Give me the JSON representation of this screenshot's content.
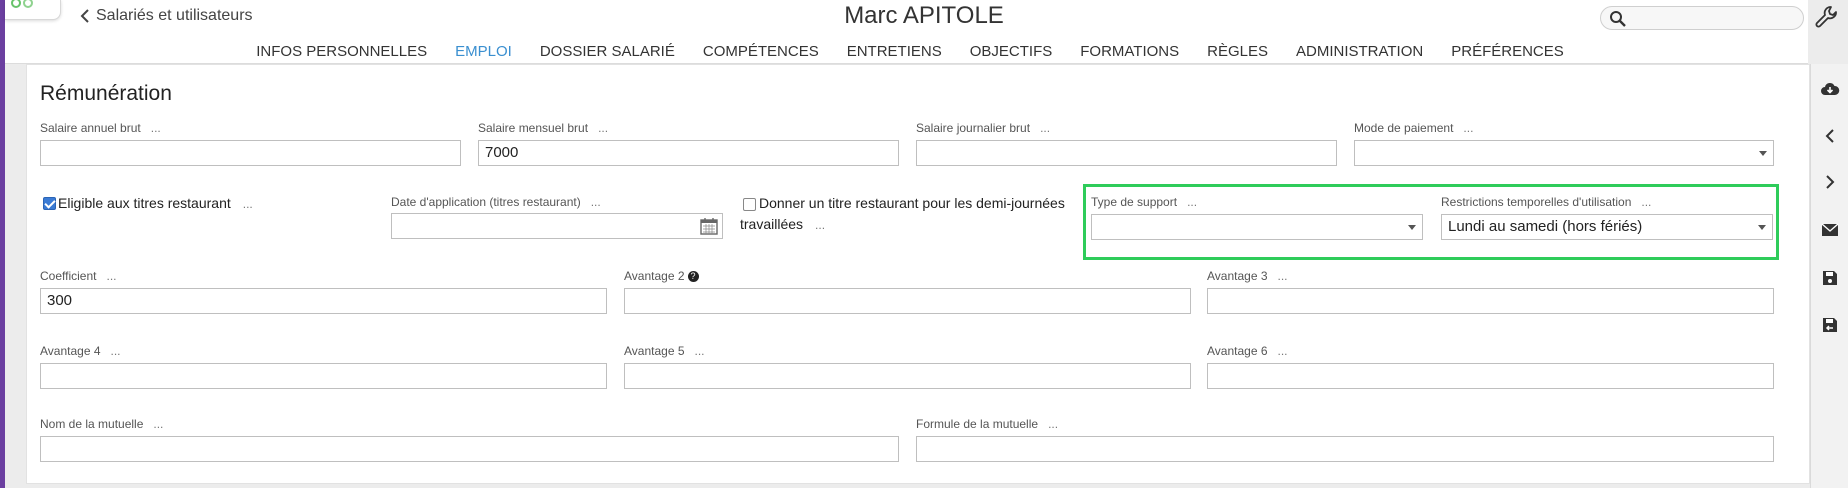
{
  "header": {
    "back_label": "Salariés et utilisateurs",
    "title": "Marc APITOLE",
    "search_placeholder": ""
  },
  "tabs": [
    {
      "label": "INFOS PERSONNELLES",
      "active": false
    },
    {
      "label": "EMPLOI",
      "active": true
    },
    {
      "label": "DOSSIER SALARIÉ",
      "active": false
    },
    {
      "label": "COMPÉTENCES",
      "active": false
    },
    {
      "label": "ENTRETIENS",
      "active": false
    },
    {
      "label": "OBJECTIFS",
      "active": false
    },
    {
      "label": "FORMATIONS",
      "active": false
    },
    {
      "label": "RÈGLES",
      "active": false
    },
    {
      "label": "ADMINISTRATION",
      "active": false
    },
    {
      "label": "PRÉFÉRENCES",
      "active": false
    }
  ],
  "section": {
    "title": "Rémunération",
    "more": "...",
    "fields": {
      "salaire_annuel": {
        "label": "Salaire annuel brut",
        "value": ""
      },
      "salaire_mensuel": {
        "label": "Salaire mensuel brut",
        "value": "7000"
      },
      "salaire_journalier": {
        "label": "Salaire journalier brut",
        "value": ""
      },
      "mode_paiement": {
        "label": "Mode de paiement",
        "value": ""
      },
      "eligible": {
        "label": "Eligible aux titres restaurant",
        "checked": true
      },
      "date_application": {
        "label": "Date d'application (titres restaurant)",
        "value": ""
      },
      "demi_journees": {
        "label_line1": "Donner un titre restaurant pour les demi-journées",
        "label_line2": "travaillées",
        "checked": false
      },
      "type_support": {
        "label": "Type de support",
        "value": ""
      },
      "restrictions": {
        "label": "Restrictions temporelles d'utilisation",
        "value": "Lundi au samedi (hors fériés)"
      },
      "coefficient": {
        "label": "Coefficient",
        "value": "300"
      },
      "avantage2": {
        "label": "Avantage 2",
        "value": ""
      },
      "avantage3": {
        "label": "Avantage 3",
        "value": ""
      },
      "avantage4": {
        "label": "Avantage 4",
        "value": ""
      },
      "avantage5": {
        "label": "Avantage 5",
        "value": ""
      },
      "avantage6": {
        "label": "Avantage 6",
        "value": ""
      },
      "mutuelle_nom": {
        "label": "Nom de la mutuelle",
        "value": ""
      },
      "mutuelle_formule": {
        "label": "Formule de la mutuelle",
        "value": ""
      }
    }
  },
  "colors": {
    "accent": "#3a8fd0",
    "highlight": "#2ecc5a",
    "brand_strip": "#6b3fa0"
  },
  "icons": [
    "chevron-left-icon",
    "search-icon",
    "wrench-icon",
    "cloud-download-icon",
    "chevron-left-icon",
    "chevron-right-icon",
    "envelope-icon",
    "save-icon",
    "save-exit-icon",
    "calendar-icon",
    "help-icon"
  ]
}
